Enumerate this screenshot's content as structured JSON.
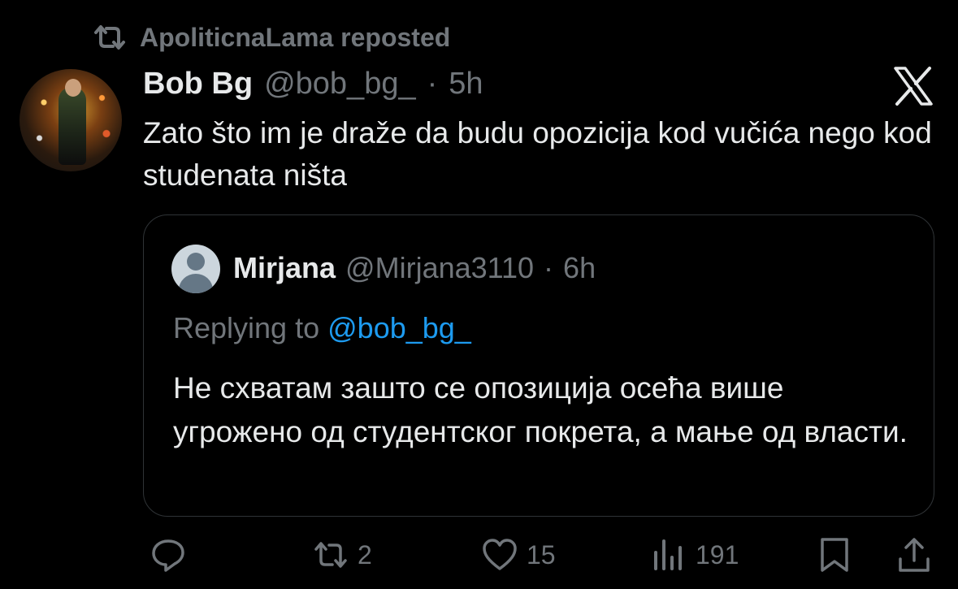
{
  "repost": {
    "text": "ApoliticnaLama reposted",
    "icon": "repost-icon"
  },
  "tweet": {
    "name": "Bob Bg",
    "handle": "@bob_bg_",
    "separator": "·",
    "time": "5h",
    "text": "Zato što im je draže da budu opozicija kod vučića nego kod studenata ništa"
  },
  "quote": {
    "name": "Mirjana",
    "handle": "@Mirjana3110",
    "separator": "·",
    "time": "6h",
    "replying_prefix": "Replying to",
    "replying_mention": "@bob_bg_",
    "text": "Не схватам зашто се опозиција осећа више угрожено од студентског покрета, а мање од власти."
  },
  "actions": {
    "reply_count": "",
    "repost_count": "2",
    "like_count": "15",
    "views_count": "191"
  },
  "colors": {
    "background": "#000000",
    "text": "#e7e9ea",
    "muted": "#71767b",
    "link": "#1d9bf0",
    "border": "#2f3336"
  }
}
